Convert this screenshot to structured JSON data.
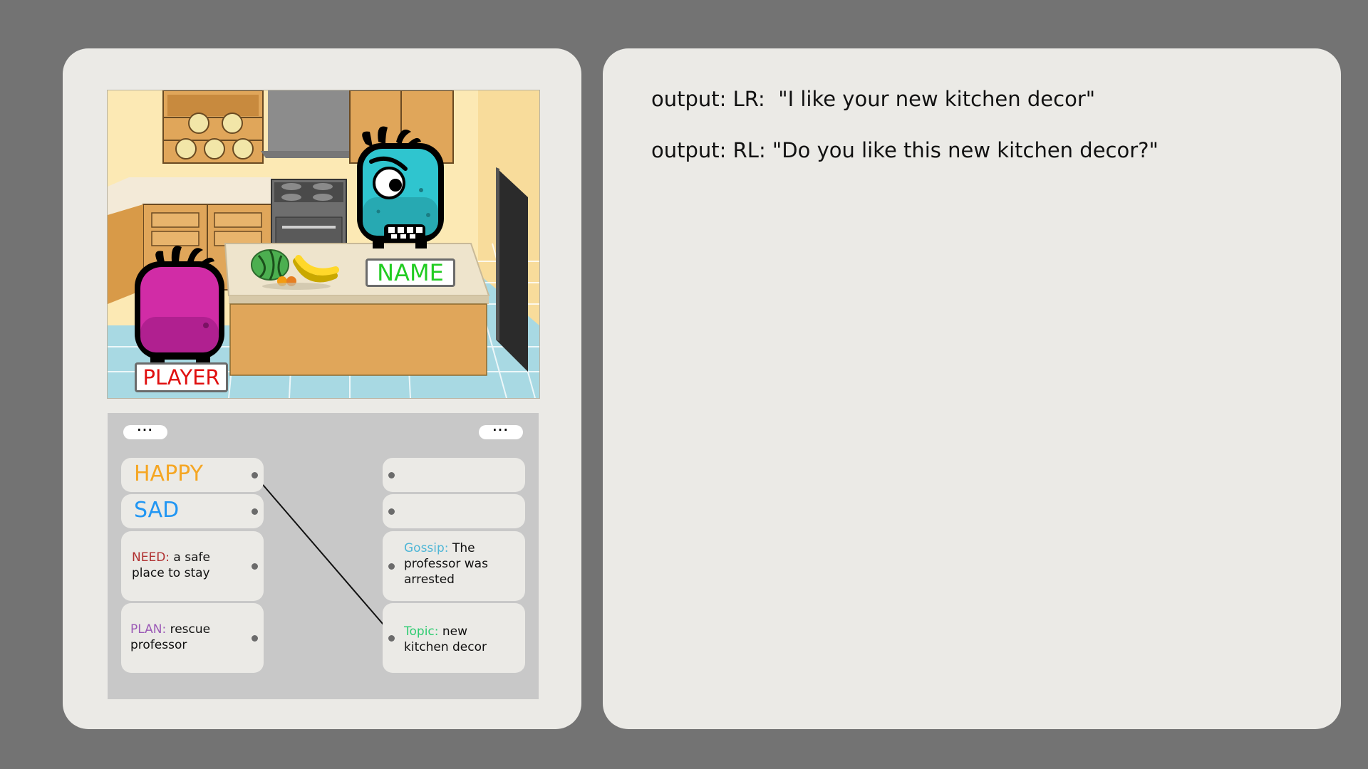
{
  "scene": {
    "npc_label": "NAME",
    "player_label": "PLAYER"
  },
  "board": {
    "left_menu": "···",
    "right_menu": "···",
    "left_cards": {
      "happy": "HAPPY",
      "sad": "SAD",
      "need_key": "NEED:",
      "need_text": " a safe place to stay",
      "plan_key": "PLAN:",
      "plan_text": " rescue professor"
    },
    "right_cards": {
      "gossip_key": "Gossip:",
      "gossip_text": " The professor was arrested",
      "topic_key": "Topic:",
      "topic_text": " new kitchen decor"
    }
  },
  "outputs": {
    "line1": "output: LR:  \"I like your new kitchen decor\"",
    "line2": "output: RL: \"Do you like this new kitchen decor?\""
  },
  "colors": {
    "background": "#737373",
    "panel": "#ebeae6",
    "happy": "#f5a623",
    "sad": "#2196f3",
    "npc_label": "#22cc22",
    "player_label": "#e01010",
    "npc_body": "#2fc5cf",
    "player_body": "#d12ca6"
  }
}
